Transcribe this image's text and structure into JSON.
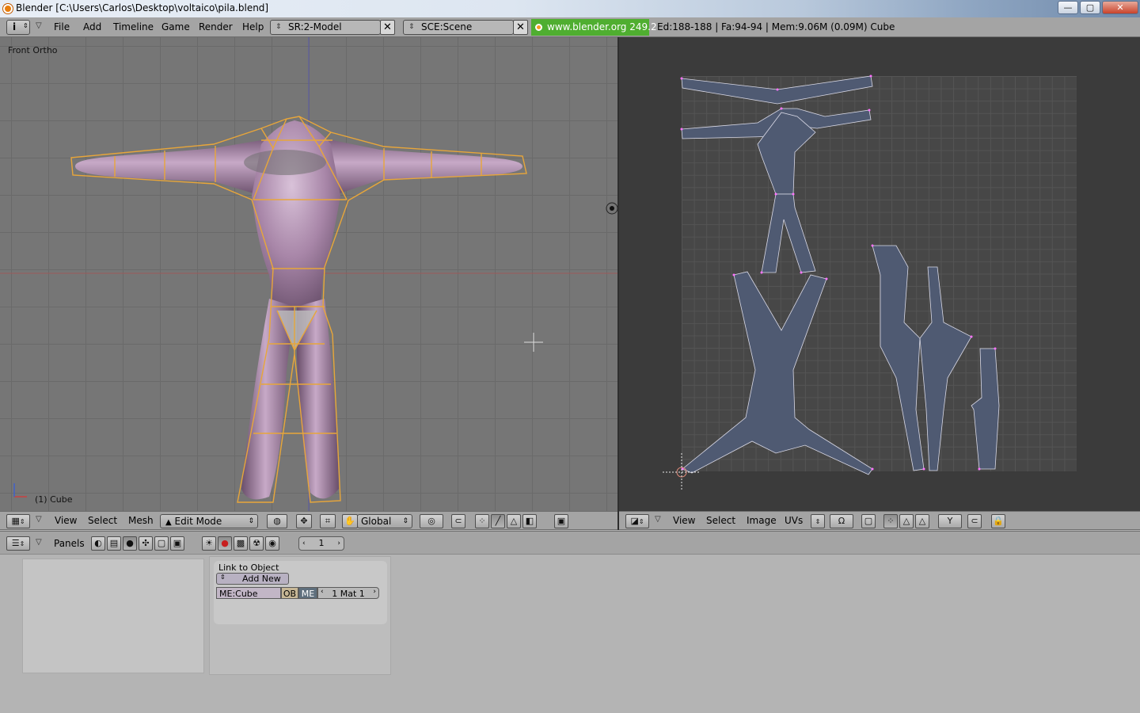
{
  "window": {
    "title": "Blender [C:\\Users\\Carlos\\Desktop\\voltaico\\pila.blend]",
    "minimize": "—",
    "maximize": "▢",
    "close": "✕"
  },
  "topbar": {
    "menus": [
      "File",
      "Add",
      "Timeline",
      "Game",
      "Render",
      "Help"
    ],
    "screen_field": "SR:2-Model",
    "scene_field": "SCE:Scene",
    "url": "www.blender.org 249.2",
    "stats": "Ed:188-188 | Fa:94-94 | Mem:9.06M (0.09M) Cube"
  },
  "view3d": {
    "label": "Front Ortho",
    "object_label": "(1) Cube"
  },
  "header3d": {
    "menus": [
      "View",
      "Select",
      "Mesh"
    ],
    "mode": "Edit Mode",
    "orientation": "Global"
  },
  "headeruv": {
    "menus": [
      "View",
      "Select",
      "Image",
      "UVs"
    ]
  },
  "buttons": {
    "panels_label": "Panels",
    "frame_number": "1",
    "link_title": "Link to Object",
    "add_new": "Add New",
    "mesh_name": "ME:Cube",
    "ob_btn": "OB",
    "me_btn": "ME",
    "material": "1 Mat 1"
  },
  "colors": {
    "mesh_fill": "#a886a8",
    "wire_selected": "#e8a63a",
    "uv_face": "#4f5a72",
    "uv_vertex": "#ff73ff",
    "url_bg": "#4fae30"
  }
}
